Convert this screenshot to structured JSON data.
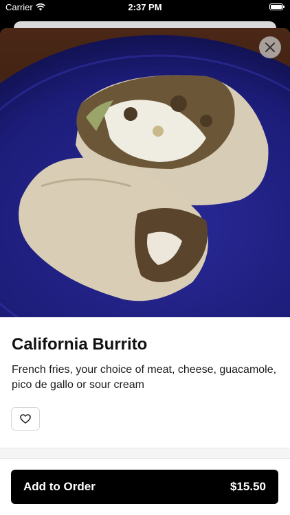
{
  "status_bar": {
    "carrier": "Carrier",
    "time": "2:37 PM"
  },
  "item": {
    "image_alt": "California Burrito photo",
    "title": "California Burrito",
    "description": "French fries, your choice of meat, cheese, guacamole, pico de gallo or sour cream"
  },
  "actions": {
    "add_label": "Add to Order",
    "price": "$15.50"
  },
  "icons": {
    "close": "close-icon",
    "favorite": "heart-icon",
    "wifi": "wifi-icon",
    "battery": "battery-icon"
  }
}
